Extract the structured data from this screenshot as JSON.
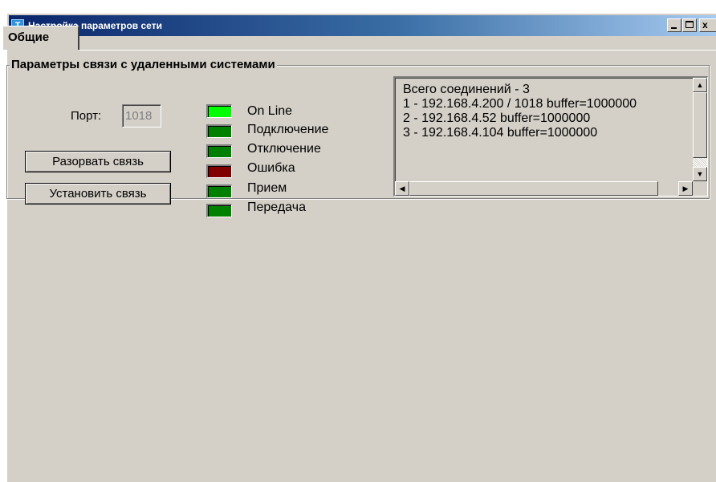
{
  "window": {
    "title": "Настройка параметров сети",
    "icon": "app-icon",
    "controls": {
      "minimize": "minimize-icon",
      "maximize": "maximize-icon",
      "close": "x"
    }
  },
  "tabs": [
    {
      "label": "Общие",
      "active": true
    }
  ],
  "group": {
    "title": "Параметры связи с удаленными системами",
    "port_label": "Порт:",
    "port_value": "1018",
    "buttons": {
      "disconnect": "Разорвать связь",
      "connect": "Установить связь"
    },
    "indicators": [
      {
        "label": "On Line",
        "color": "#00ff00"
      },
      {
        "label": "Подключение",
        "color": "#008000"
      },
      {
        "label": "Отключение",
        "color": "#008000"
      },
      {
        "label": "Ошибка",
        "color": "#800000"
      },
      {
        "label": "Прием",
        "color": "#008000"
      },
      {
        "label": "Передача",
        "color": "#008000"
      }
    ]
  },
  "connections": {
    "lines": [
      "Всего соединений - 3",
      "1 - 192.168.4.200 / 1018 buffer=1000000",
      "2 - 192.168.4.52 buffer=1000000",
      "3 - 192.168.4.104 buffer=1000000"
    ]
  }
}
